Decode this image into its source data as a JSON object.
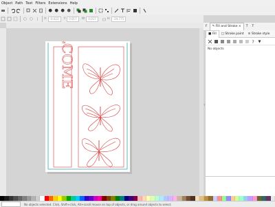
{
  "menu": [
    "Object",
    "Path",
    "Text",
    "Filters",
    "Extensions",
    "Help"
  ],
  "toolbar2": {
    "x_label": "X:",
    "x_value": "-0.022",
    "y_label": "Y:",
    "y_value": "0.017",
    "w_label": "W:",
    "w_value": "0.017",
    "h_label": "H:",
    "h_value": "-24.775"
  },
  "right_tabs": [
    "F",
    "Fill and Stroke",
    "T",
    "T"
  ],
  "sub_tabs": [
    "Fill",
    "Stroke paint",
    "Stroke style"
  ],
  "panel": {
    "message": "No objects"
  },
  "canvas": {
    "welcome_text": "WELCOME"
  },
  "palette": [
    "#000000",
    "#1a1a1a",
    "#333333",
    "#4d4d4d",
    "#666666",
    "#808080",
    "#999999",
    "#b3b3b3",
    "#cccccc",
    "#ffffff",
    "#ff0000",
    "#ff6600",
    "#ffcc00",
    "#ffff00",
    "#99cc00",
    "#00aa00",
    "#00cc99",
    "#00ccff",
    "#0066ff",
    "#3300cc",
    "#6600cc",
    "#cc00cc",
    "#ff0099",
    "#800000",
    "#804000",
    "#808000",
    "#008000",
    "#008080",
    "#000080",
    "#400080",
    "#800040",
    "#ffb3b3",
    "#ffd9b3",
    "#ffffb3",
    "#d9ffb3",
    "#b3ffd9",
    "#b3e6ff",
    "#b3c6ff",
    "#d9b3ff",
    "#ffb3e6",
    "#c8b89a",
    "#a08060",
    "#705030",
    "#503020",
    "#f0e0c0",
    "#e0c080",
    "#c09040",
    "#907030",
    "#d0d0ff",
    "#ff9090",
    "#90ff90",
    "#9090ff",
    "#ffcc99",
    "#ccff99",
    "#99ffcc",
    "#99ccff",
    "#cc99ff",
    "#ff99cc",
    "#666633",
    "#336666",
    "#663366",
    "#e8e8e8"
  ],
  "status": {
    "text": "No objects selected. Click, Shift+click, Alt+scroll mouse on top of objects, or drag around objects to select."
  },
  "colors": {
    "design_stroke": "#d93a3a",
    "guide": "#2aa7b0"
  }
}
